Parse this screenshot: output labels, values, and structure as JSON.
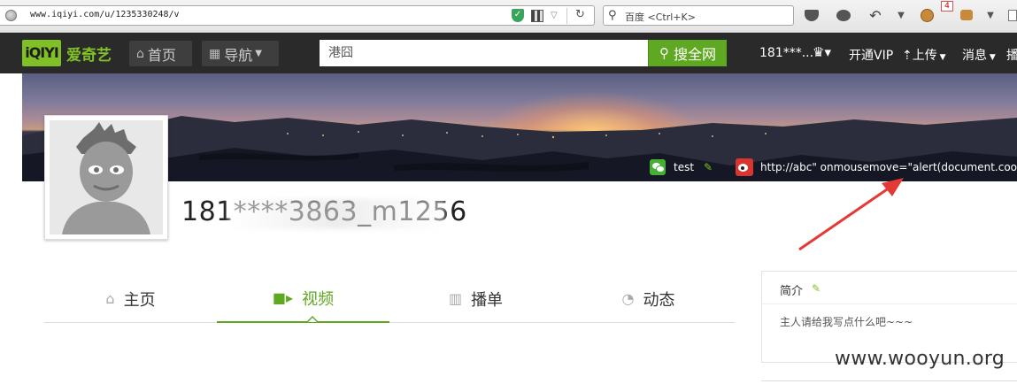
{
  "browser": {
    "url": "www.iqiyi.com/u/1235330248/v",
    "search_placeholder": "百度 <Ctrl+K>",
    "badge_count": "4"
  },
  "header": {
    "logo": "iQIYI",
    "logo_text": "爱奇艺",
    "home": "首页",
    "nav": "导航",
    "search_value": "港囧",
    "search_button": "搜全网",
    "user": "181***...",
    "vip": "开通VIP",
    "upload": "上传",
    "messages": "消息",
    "more": "播"
  },
  "banner": {
    "wechat": "test",
    "weibo": "http://abc\" onmousemove=\"alert(document.cooki"
  },
  "profile": {
    "username": "181****3863_m1256"
  },
  "tabs": [
    {
      "label": "主页",
      "icon": "home-icon"
    },
    {
      "label": "视频",
      "icon": "video-icon",
      "active": true
    },
    {
      "label": "播单",
      "icon": "book-icon"
    },
    {
      "label": "动态",
      "icon": "clock-icon"
    }
  ],
  "intro": {
    "title": "简介",
    "text": "主人请给我写点什么吧~~~"
  },
  "watermark": "www.wooyun.org",
  "colors": {
    "brand": "#80c026",
    "accent": "#5fa821",
    "header_bg": "#2a2a2a",
    "annotation": "#e53935"
  }
}
